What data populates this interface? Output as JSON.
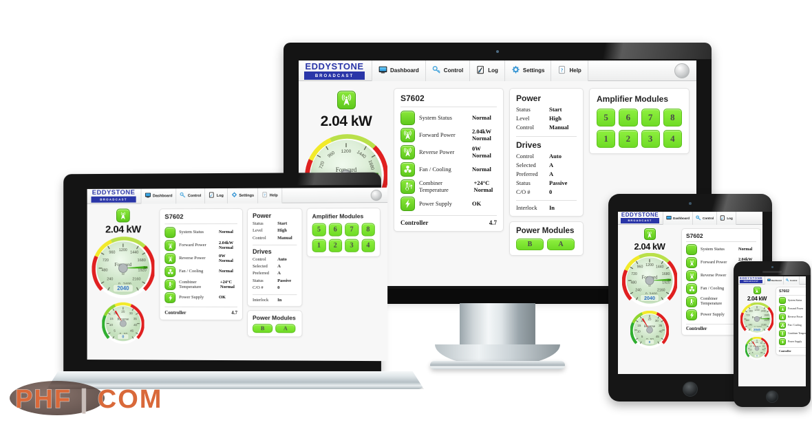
{
  "brand": {
    "name": "EDDYSTONE",
    "sub": "BROADCAST"
  },
  "nav": {
    "items": [
      {
        "label": "Dashboard",
        "icon": "monitor-icon"
      },
      {
        "label": "Control",
        "icon": "key-icon"
      },
      {
        "label": "Log",
        "icon": "notepad-icon"
      },
      {
        "label": "Settings",
        "icon": "gear-icon"
      },
      {
        "label": "Help",
        "icon": "question-icon"
      }
    ]
  },
  "meters": {
    "header_icon": "antenna-icon",
    "big_value": "2.04 kW",
    "forward": {
      "label": "Forward",
      "readout": "2040",
      "ticks": [
        "0",
        "240",
        "480",
        "720",
        "960",
        "1200",
        "1440",
        "1680",
        "1920",
        "2160",
        "2400"
      ],
      "min": 0,
      "max": 2400,
      "value": 2040
    },
    "reverse": {
      "label": "Reverse",
      "readout": "0",
      "ticks": [
        "0",
        "5",
        "10",
        "15",
        "20",
        "25",
        "30",
        "35",
        "40",
        "45",
        "50"
      ],
      "min": 0,
      "max": 50,
      "value": 0
    }
  },
  "status": {
    "title": "S7602",
    "rows": [
      {
        "icon": "blank-status-icon",
        "label": "System Status",
        "value": "Normal"
      },
      {
        "icon": "antenna-icon",
        "label": "Forward Power",
        "value": "2.04kW\nNormal"
      },
      {
        "icon": "antenna-icon",
        "label": "Reverse Power",
        "value": "0W\nNormal"
      },
      {
        "icon": "fan-icon",
        "label": "Fan / Cooling",
        "value": "Normal"
      },
      {
        "icon": "thermometer-icon",
        "label": "Combiner Temperature",
        "value": "+24°C\nNormal"
      },
      {
        "icon": "bolt-icon",
        "label": "Power Supply",
        "value": "OK"
      }
    ],
    "footer": {
      "label": "Controller",
      "value": "4.7"
    }
  },
  "power_panel": {
    "sections": [
      {
        "title": "Power",
        "rows": [
          {
            "k": "Status",
            "v": "Start"
          },
          {
            "k": "Level",
            "v": "High"
          },
          {
            "k": "Control",
            "v": "Manual"
          }
        ]
      },
      {
        "title": "Drives",
        "rows": [
          {
            "k": "Control",
            "v": "Auto"
          },
          {
            "k": "Selected",
            "v": "A"
          },
          {
            "k": "Preferred",
            "v": "A"
          },
          {
            "k": "Status",
            "v": "Passive"
          },
          {
            "k": "C/O #",
            "v": "0"
          }
        ]
      }
    ],
    "interlock": {
      "k": "Interlock",
      "v": "In"
    }
  },
  "amplifier_modules": {
    "title": "Amplifier Modules",
    "top_row": [
      "5",
      "6",
      "7",
      "8"
    ],
    "bottom_row": [
      "1",
      "2",
      "3",
      "4"
    ]
  },
  "power_modules": {
    "title": "Power Modules",
    "items": [
      "B",
      "A"
    ]
  },
  "watermark": {
    "text_a": "PHF",
    "text_b": "COM"
  },
  "colors": {
    "brand_blue": "#2a36a8",
    "module_green": "#6fdb25",
    "status_green": "#5ec81c",
    "gauge_red": "#e02020",
    "gauge_yellow": "#f2ea2a",
    "watermark_orange": "#d9693a"
  }
}
